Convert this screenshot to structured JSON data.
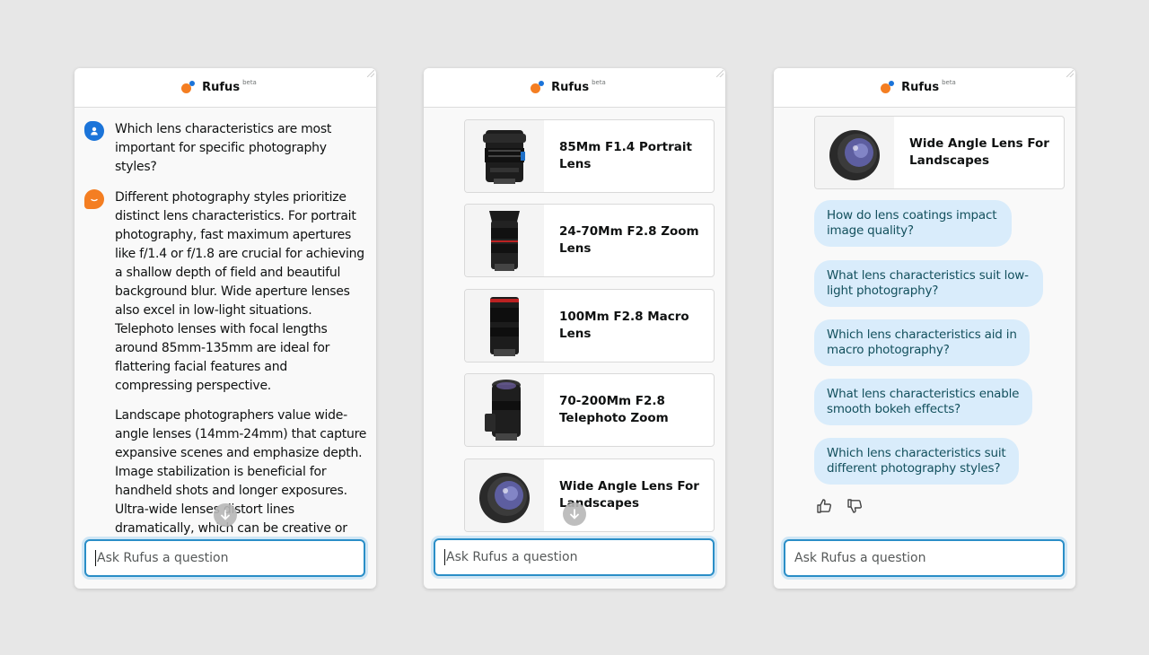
{
  "app": {
    "brand": "Rufus",
    "badge": "beta"
  },
  "panel1": {
    "user_question": "Which lens characteristics are most important for specific photography styles?",
    "bot_paragraphs": [
      "Different photography styles prioritize distinct lens characteristics. For portrait photography, fast maximum apertures like f/1.4 or f/1.8 are crucial for achieving a shallow depth of field and beautiful background blur. Wide aperture lenses also excel in low-light situations. Telephoto lenses with focal lengths around 85mm-135mm are ideal for flattering facial features and compressing perspective.",
      "Landscape photographers value wide-angle lenses (14mm-24mm) that capture expansive scenes and emphasize depth. Image stabilization is beneficial for handheld shots and longer exposures. Ultra-wide lenses distort lines dramatically, which can be creative or"
    ]
  },
  "panel2": {
    "products": [
      {
        "title": "85Mm F1.4 Portrait Lens",
        "image": "portrait-lens-image"
      },
      {
        "title": "24-70Mm F2.8 Zoom Lens",
        "image": "zoom-lens-image"
      },
      {
        "title": "100Mm F2.8 Macro Lens",
        "image": "macro-lens-image"
      },
      {
        "title": "70-200Mm F2.8 Telephoto Zoom",
        "image": "telephoto-lens-image"
      },
      {
        "title": "Wide Angle Lens For Landscapes",
        "image": "wide-angle-lens-image"
      }
    ]
  },
  "panel3": {
    "product": {
      "title": "Wide Angle Lens For Landscapes",
      "image": "wide-angle-lens-image"
    },
    "suggestions": [
      "How do lens coatings impact image quality?",
      "What lens characteristics suit low-light photography?",
      "Which lens characteristics aid in macro photography?",
      "What lens characteristics enable smooth bokeh effects?",
      "Which lens characteristics suit different photography styles?"
    ]
  },
  "input": {
    "placeholder": "Ask Rufus a question"
  },
  "colors": {
    "accent": "#2a8ec7",
    "chip_bg": "#d9ecfb",
    "chip_text": "#13505d",
    "brand_orange": "#f47e22",
    "brand_blue": "#1b74d9"
  }
}
